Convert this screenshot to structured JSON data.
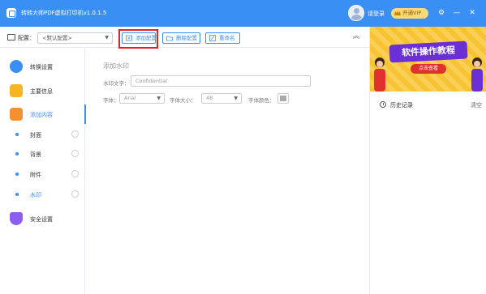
{
  "app": {
    "title": "转转大师PDF虚拟打印机v1.0.1.5",
    "login_label": "请登录",
    "vip_label": "开通VIP",
    "accent_color": "#3a8ff5"
  },
  "window_controls": {
    "settings_glyph": "⚙",
    "minimize_glyph": "—",
    "close_glyph": "✕"
  },
  "toolbar": {
    "config_label": "配置：",
    "config_selected": "<默认配置>",
    "add_config_label": "添加配置",
    "delete_config_label": "删除配置",
    "rename_label": "重命名"
  },
  "sidebar": {
    "items": [
      {
        "label": "转换设置",
        "icon": "convert-settings-icon"
      },
      {
        "label": "主要信息",
        "icon": "folder-info-icon"
      },
      {
        "label": "添加内容",
        "icon": "add-content-icon"
      }
    ],
    "sub_items": [
      {
        "label": "封面"
      },
      {
        "label": "背景"
      },
      {
        "label": "附件"
      },
      {
        "label": "水印"
      }
    ],
    "security": {
      "label": "安全设置",
      "icon": "shield-icon"
    }
  },
  "main": {
    "section_title": "添加水印",
    "watermark_text_label": "水印文字：",
    "watermark_text_placeholder": "Confidential",
    "font_label": "字体：",
    "font_value": "Arial",
    "font_size_label": "字体大小：",
    "font_size_value": "48",
    "font_color_label": "字体颜色："
  },
  "right_panel": {
    "banner_title": "软件操作教程",
    "banner_cta": "点击查看",
    "history_label": "历史记录",
    "clear_label": "清空"
  }
}
